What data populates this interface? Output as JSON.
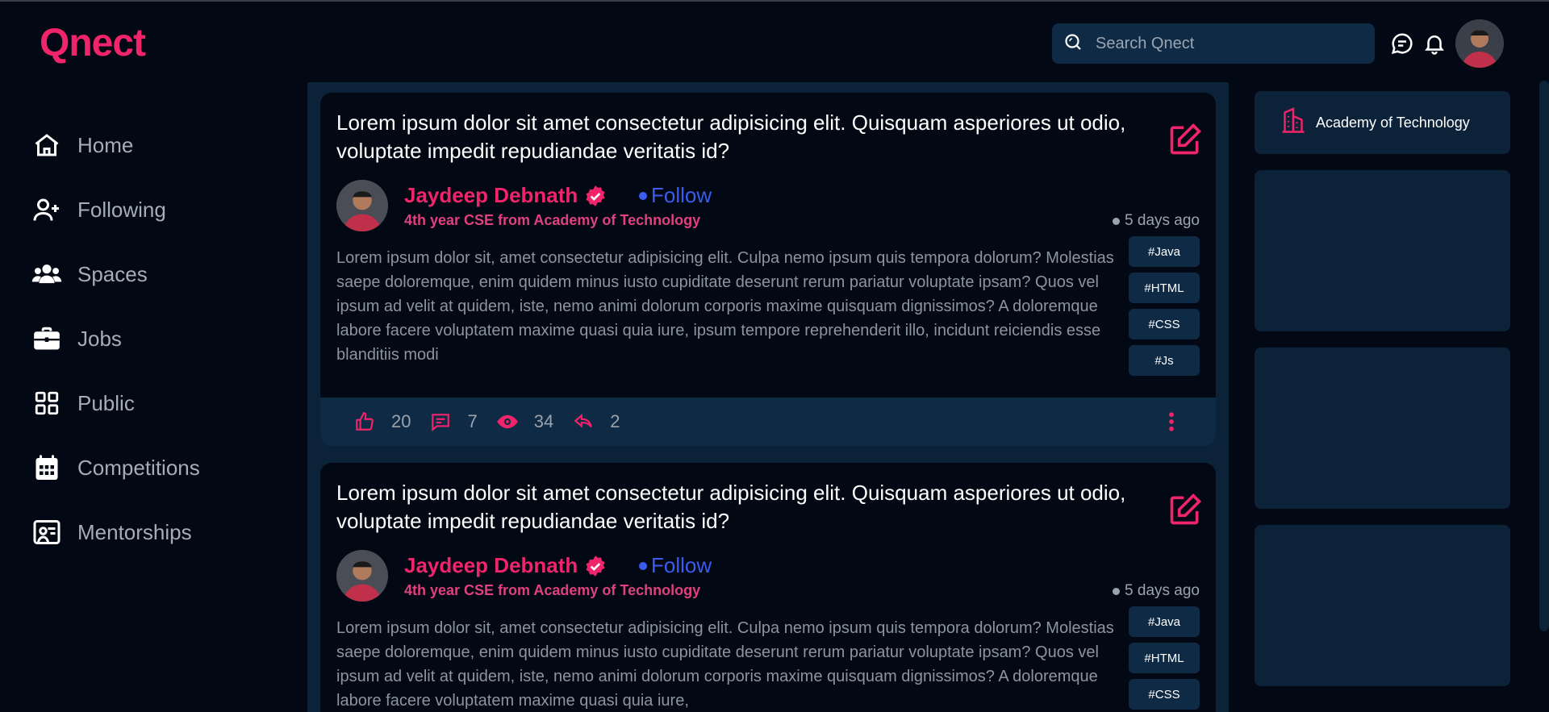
{
  "app": {
    "logo": "Qnect"
  },
  "search": {
    "placeholder": "Search Qnect"
  },
  "nav": [
    {
      "label": "Home",
      "icon": "home-icon"
    },
    {
      "label": "Following",
      "icon": "user-plus-icon"
    },
    {
      "label": "Spaces",
      "icon": "users-icon"
    },
    {
      "label": "Jobs",
      "icon": "briefcase-icon"
    },
    {
      "label": "Public",
      "icon": "grid-icon"
    },
    {
      "label": "Competitions",
      "icon": "calendar-icon"
    },
    {
      "label": "Mentorships",
      "icon": "mentor-icon"
    }
  ],
  "posts": [
    {
      "title": "Lorem ipsum dolor sit amet consectetur adipisicing elit. Quisquam asperiores ut odio, voluptate impedit repudiandae veritatis id?",
      "author": "Jaydeep Debnath",
      "follow": "Follow",
      "subtitle": "4th year CSE from Academy of Technology",
      "time": "5 days ago",
      "body": "Lorem ipsum dolor sit, amet consectetur adipisicing elit. Culpa nemo ipsum quis tempora dolorum? Molestias saepe doloremque, enim quidem minus iusto cupiditate deserunt rerum pariatur voluptate ipsam? Quos vel ipsum ad velit at quidem, iste, nemo animi dolorum corporis maxime quisquam dignissimos? A doloremque labore facere voluptatem maxime quasi quia iure, ipsum tempore reprehenderit illo, incidunt reiciendis esse blanditiis modi",
      "tags": [
        "#Java",
        "#HTML",
        "#CSS",
        "#Js"
      ],
      "likes": "20",
      "comments": "7",
      "views": "34",
      "shares": "2"
    },
    {
      "title": "Lorem ipsum dolor sit amet consectetur adipisicing elit. Quisquam asperiores ut odio, voluptate impedit repudiandae veritatis id?",
      "author": "Jaydeep Debnath",
      "follow": "Follow",
      "subtitle": "4th year CSE from Academy of Technology",
      "time": "5 days ago",
      "body": "Lorem ipsum dolor sit, amet consectetur adipisicing elit. Culpa nemo ipsum quis tempora dolorum? Molestias saepe doloremque, enim quidem minus iusto cupiditate deserunt rerum pariatur voluptate ipsam? Quos vel ipsum ad velit at quidem, iste, nemo animi dolorum corporis maxime quisquam dignissimos? A doloremque labore facere voluptatem maxime quasi quia iure,",
      "tags": [
        "#Java",
        "#HTML",
        "#CSS"
      ]
    }
  ],
  "right_panel": {
    "institution": "Academy of Technology"
  },
  "colors": {
    "accent": "#f0246a",
    "follow": "#3a5cf0",
    "panel": "#0c2238",
    "background": "#020814"
  }
}
